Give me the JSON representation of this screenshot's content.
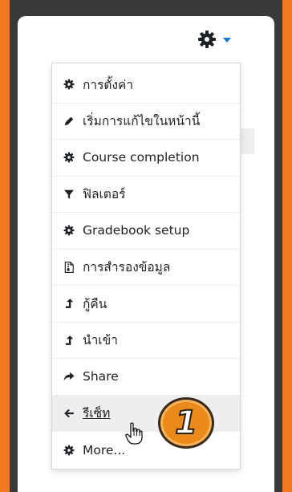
{
  "menu": {
    "items": [
      {
        "label": "การตั้งค่า",
        "icon": "gear-icon"
      },
      {
        "label": "เริ่มการแก้ไขในหน้านี้",
        "icon": "pencil-icon"
      },
      {
        "label": "Course completion",
        "icon": "gear-icon"
      },
      {
        "label": "ฟิลเตอร์",
        "icon": "filter-icon"
      },
      {
        "label": "Gradebook setup",
        "icon": "gear-icon"
      },
      {
        "label": "การสำรองข้อมูล",
        "icon": "file-archive-icon"
      },
      {
        "label": "กู้คืน",
        "icon": "level-up-icon"
      },
      {
        "label": "นำเข้า",
        "icon": "level-up-icon"
      },
      {
        "label": "Share",
        "icon": "share-icon"
      },
      {
        "label": "รีเซ็ท",
        "icon": "arrow-left-icon"
      },
      {
        "label": "More...",
        "icon": "gear-icon"
      }
    ]
  },
  "callout": {
    "number": "1"
  },
  "colors": {
    "frame": "#f47a22",
    "caret": "#1177d1",
    "callout": "#e98a1a"
  }
}
